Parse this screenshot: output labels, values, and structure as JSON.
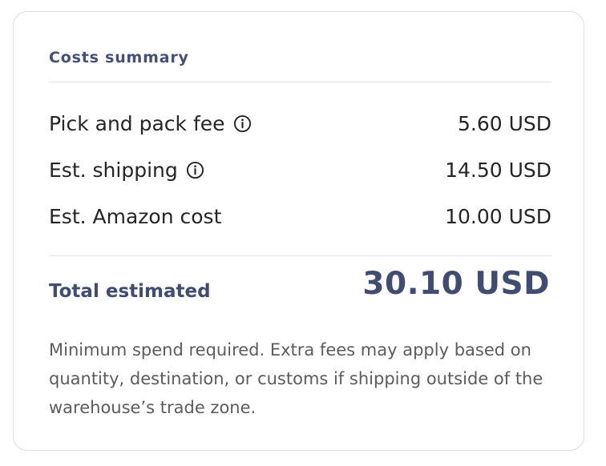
{
  "card": {
    "title": "Costs summary",
    "rows": [
      {
        "label": "Pick and pack fee",
        "value": "5.60 USD",
        "has_info_icon": true,
        "icon": "info-icon"
      },
      {
        "label": "Est. shipping",
        "value": "14.50 USD",
        "has_info_icon": true,
        "icon": "info-icon"
      },
      {
        "label": "Est. Amazon cost",
        "value": "10.00 USD",
        "has_info_icon": false
      }
    ],
    "total": {
      "label": "Total estimated",
      "value": "30.10 USD"
    },
    "note": "Minimum spend required. Extra fees may apply based on quantity, destination, or customs if shipping outside of the warehouse’s trade zone."
  },
  "colors": {
    "accent": "#414c72",
    "text": "#252525",
    "muted": "#5c5c5c",
    "border": "#dedede"
  }
}
